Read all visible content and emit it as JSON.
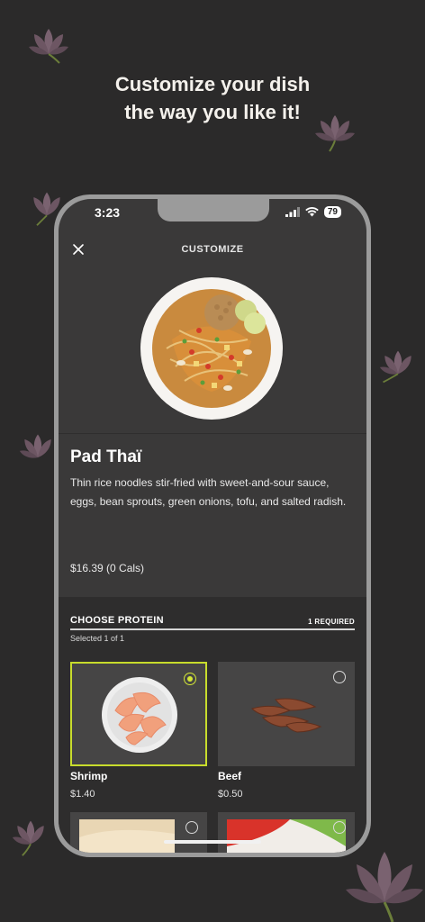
{
  "headline": {
    "line1": "Customize your dish",
    "line2": "the way you like it!"
  },
  "status_bar": {
    "time": "3:23",
    "battery": "79"
  },
  "nav": {
    "title": "CUSTOMIZE",
    "close_icon": "close-icon"
  },
  "dish": {
    "name": "Pad Thaï",
    "description": "Thin rice noodles stir-fried with sweet-and-sour sauce, eggs, bean sprouts, green onions, tofu, and salted radish.",
    "price": "$16.39 (0 Cals)"
  },
  "protein": {
    "title": "CHOOSE PROTEIN",
    "required": "1 REQUIRED",
    "selected_count": "Selected 1 of 1",
    "options": [
      {
        "name": "Shrimp",
        "price": "$1.40",
        "selected": true
      },
      {
        "name": "Beef",
        "price": "$0.50",
        "selected": false
      }
    ]
  },
  "colors": {
    "background": "#2b2a2a",
    "accent": "#c8dc2c",
    "screen": "#3a3939"
  }
}
